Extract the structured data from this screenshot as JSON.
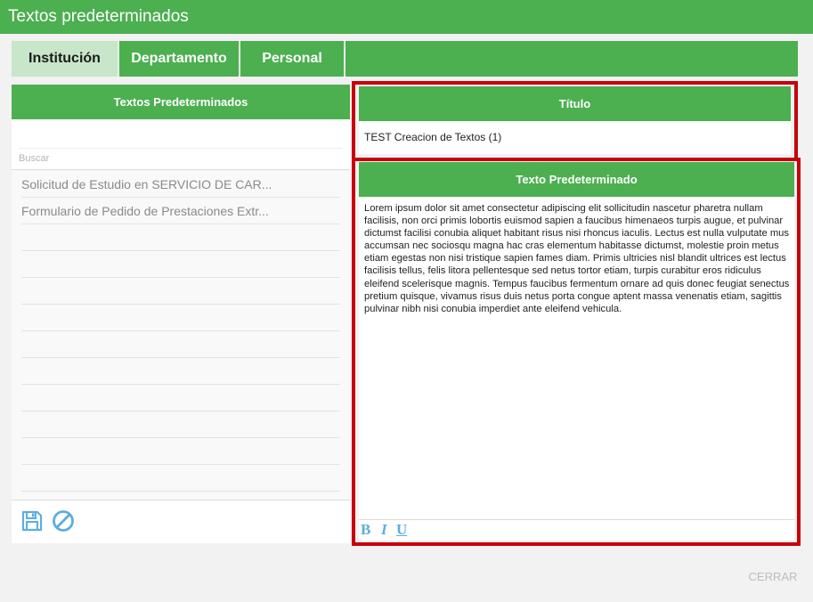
{
  "window": {
    "title": "Textos predeterminados"
  },
  "tabs": [
    {
      "label": "Institución",
      "active": true
    },
    {
      "label": "Departamento",
      "active": false
    },
    {
      "label": "Personal",
      "active": false
    }
  ],
  "left_panel": {
    "header": "Textos Predeterminados",
    "search_placeholder": "Buscar",
    "items": [
      "Solicitud de Estudio en SERVICIO DE CAR...",
      "Formulario de Pedido de Prestaciones Extr..."
    ],
    "footer_icons": [
      "save-icon",
      "cancel-icon"
    ]
  },
  "title_section": {
    "header": "Título",
    "value": "TEST Creacion de Textos (1)"
  },
  "text_section": {
    "header": "Texto Predeterminado",
    "body": "Lorem ipsum dolor sit amet consectetur adipiscing elit sollicitudin nascetur pharetra nullam facilisis, non orci primis lobortis euismod sapien a faucibus himenaeos turpis augue, et pulvinar dictumst facilisi conubia aliquet habitant risus nisi rhoncus iaculis. Lectus est nulla vulputate mus accumsan nec sociosqu magna hac cras elementum habitasse dictumst, molestie proin metus etiam egestas non nisi tristique sapien fames diam. Primis ultricies nisl blandit ultrices est lectus facilisis tellus, felis litora pellentesque sed netus tortor etiam, turpis curabitur eros ridiculus eleifend scelerisque magnis. Tempus faucibus fermentum ornare ad quis donec feugiat senectus pretium quisque, vivamus risus duis netus porta congue aptent massa venenatis etiam, sagittis pulvinar nibh nisi conubia imperdiet ante eleifend vehicula.",
    "format_buttons": {
      "bold": "B",
      "italic": "I",
      "underline": "U"
    }
  },
  "footer": {
    "close_label": "CERRAR"
  },
  "colors": {
    "accent": "#4caf50",
    "active_tab": "#c8e6c9",
    "highlight": "#c8000a",
    "icon": "#5aaee0"
  }
}
